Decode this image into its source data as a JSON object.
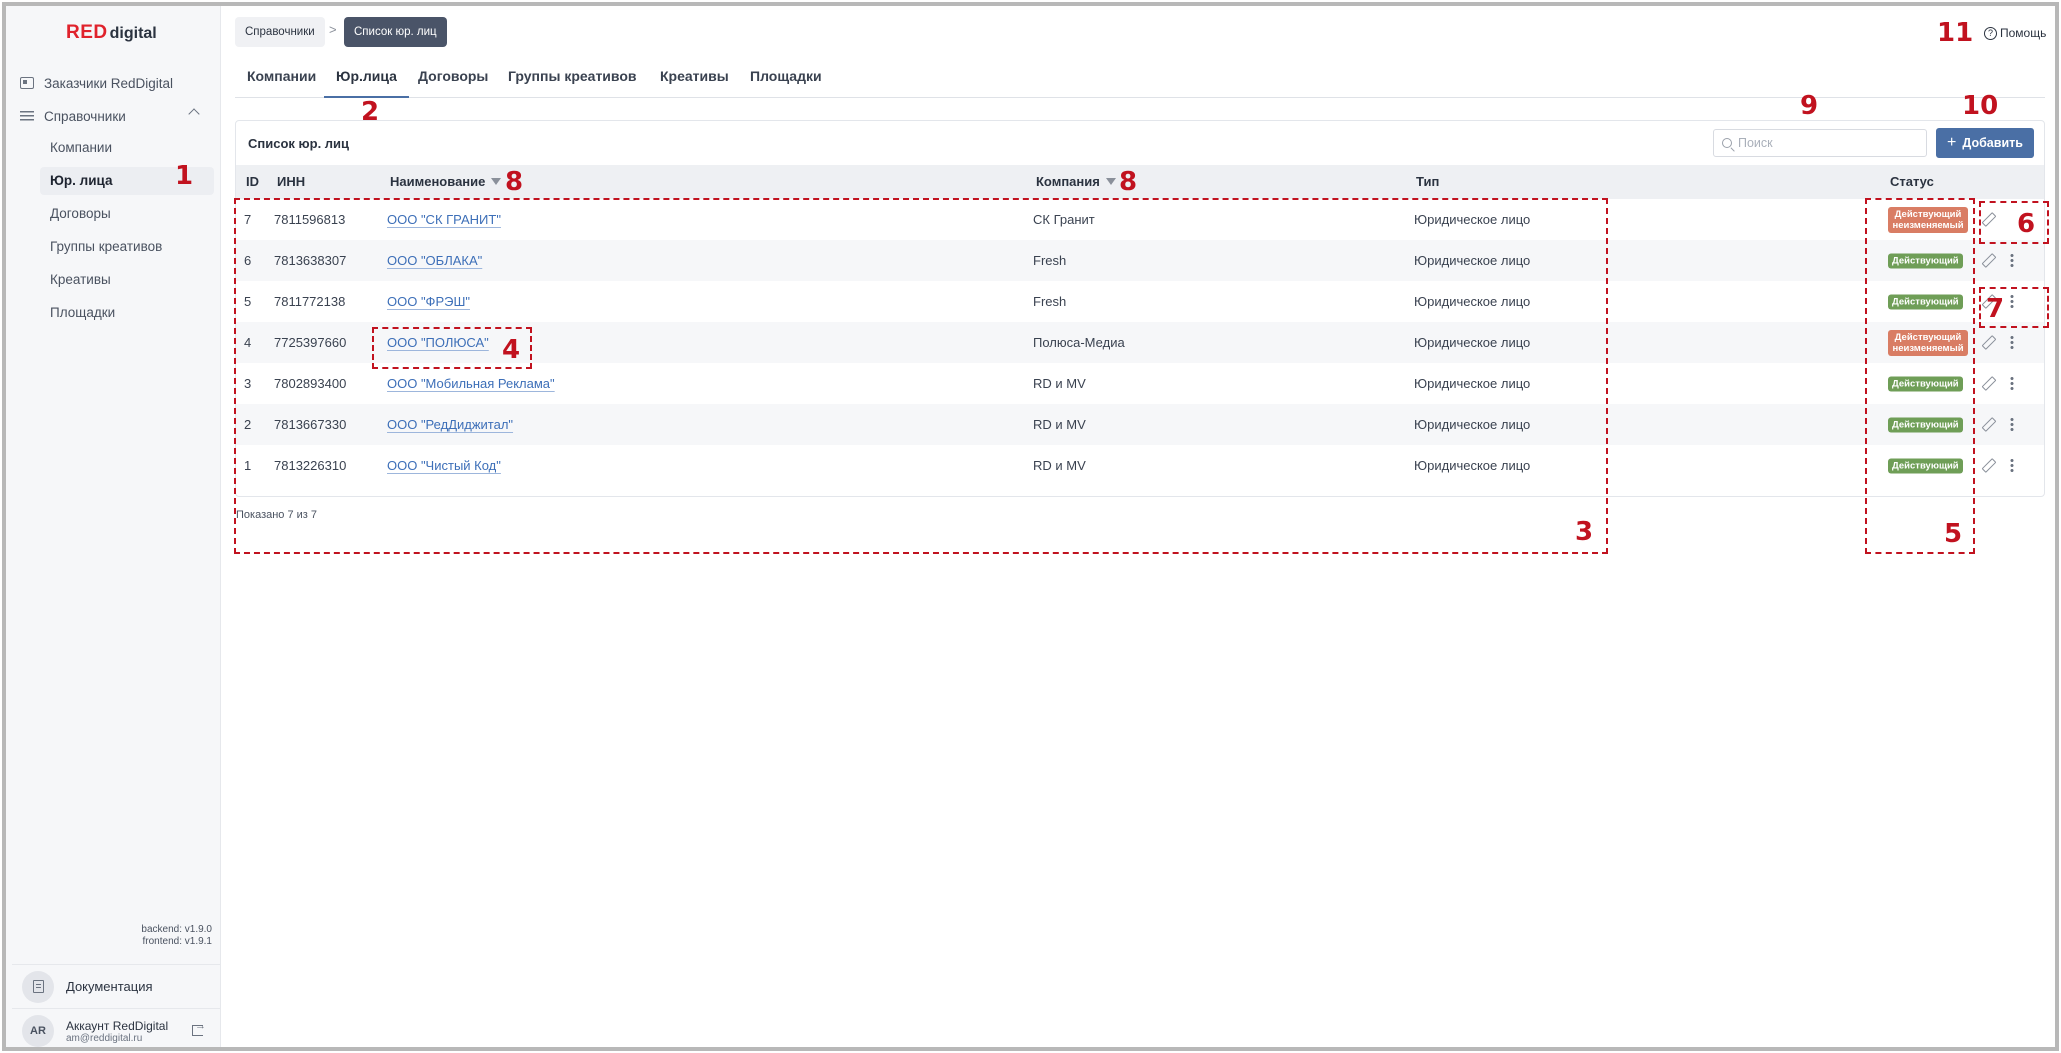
{
  "sidebar": {
    "logo": {
      "red": "RED",
      "rest": "digital"
    },
    "customers": "Заказчики RedDigital",
    "references": "Справочники",
    "items": [
      {
        "label": "Компании"
      },
      {
        "label": "Юр. лица"
      },
      {
        "label": "Договоры"
      },
      {
        "label": "Группы креативов"
      },
      {
        "label": "Креативы"
      },
      {
        "label": "Площадки"
      }
    ],
    "backend_version": "backend: v1.9.0",
    "frontend_version": "frontend: v1.9.1",
    "documentation": "Документация",
    "account": {
      "initials": "AR",
      "name": "Аккаунт RedDigital",
      "email": "am@reddigital.ru"
    }
  },
  "header": {
    "breadcrumb_parent": "Справочники",
    "breadcrumb_separator": ">",
    "breadcrumb_current": "Список юр. лиц",
    "help": "Помощь"
  },
  "tabs": [
    {
      "label": "Компании"
    },
    {
      "label": "Юр.лица"
    },
    {
      "label": "Договоры"
    },
    {
      "label": "Группы креативов"
    },
    {
      "label": "Креативы"
    },
    {
      "label": "Площадки"
    }
  ],
  "card": {
    "title": "Список юр. лиц",
    "search_placeholder": "Поиск",
    "add_label": "Добавить",
    "columns": {
      "id": "ID",
      "inn": "ИНН",
      "name": "Наименование",
      "company": "Компания",
      "type": "Тип",
      "status": "Статус"
    },
    "rows": [
      {
        "id": "7",
        "inn": "7811596813",
        "name": "ООО \"СК ГРАНИТ\"",
        "company": "СК Гранит",
        "type": "Юридическое лицо",
        "status": "Действующий неизменяемый"
      },
      {
        "id": "6",
        "inn": "7813638307",
        "name": "ООО \"ОБЛАКА\"",
        "company": "Fresh",
        "type": "Юридическое лицо",
        "status": "Действующий"
      },
      {
        "id": "5",
        "inn": "7811772138",
        "name": "ООО \"ФРЭШ\"",
        "company": "Fresh",
        "type": "Юридическое лицо",
        "status": "Действующий"
      },
      {
        "id": "4",
        "inn": "7725397660",
        "name": "ООО \"ПОЛЮСА\"",
        "company": "Полюса-Медиа",
        "type": "Юридическое лицо",
        "status": "Действующий неизменяемый"
      },
      {
        "id": "3",
        "inn": "7802893400",
        "name": "ООО \"Мобильная Реклама\"",
        "company": "RD и MV",
        "type": "Юридическое лицо",
        "status": "Действующий"
      },
      {
        "id": "2",
        "inn": "7813667330",
        "name": "ООО \"РедДиджитал\"",
        "company": "RD и MV",
        "type": "Юридическое лицо",
        "status": "Действующий"
      },
      {
        "id": "1",
        "inn": "7813226310",
        "name": "ООО \"Чистый Код\"",
        "company": "RD и MV",
        "type": "Юридическое лицо",
        "status": "Действующий"
      }
    ],
    "status_line1": "Действующий",
    "status_line2": "неизменяемый",
    "shown": "Показано 7 из 7"
  },
  "annotations": [
    "1",
    "2",
    "3",
    "4",
    "5",
    "6",
    "7",
    "8",
    "9",
    "10",
    "11"
  ],
  "colors": {
    "brand_red": "#e0222c",
    "accent": "#4a6fa5",
    "annotation": "#c1121f",
    "status_active": "#6f9e57",
    "status_locked": "#d97d64"
  }
}
